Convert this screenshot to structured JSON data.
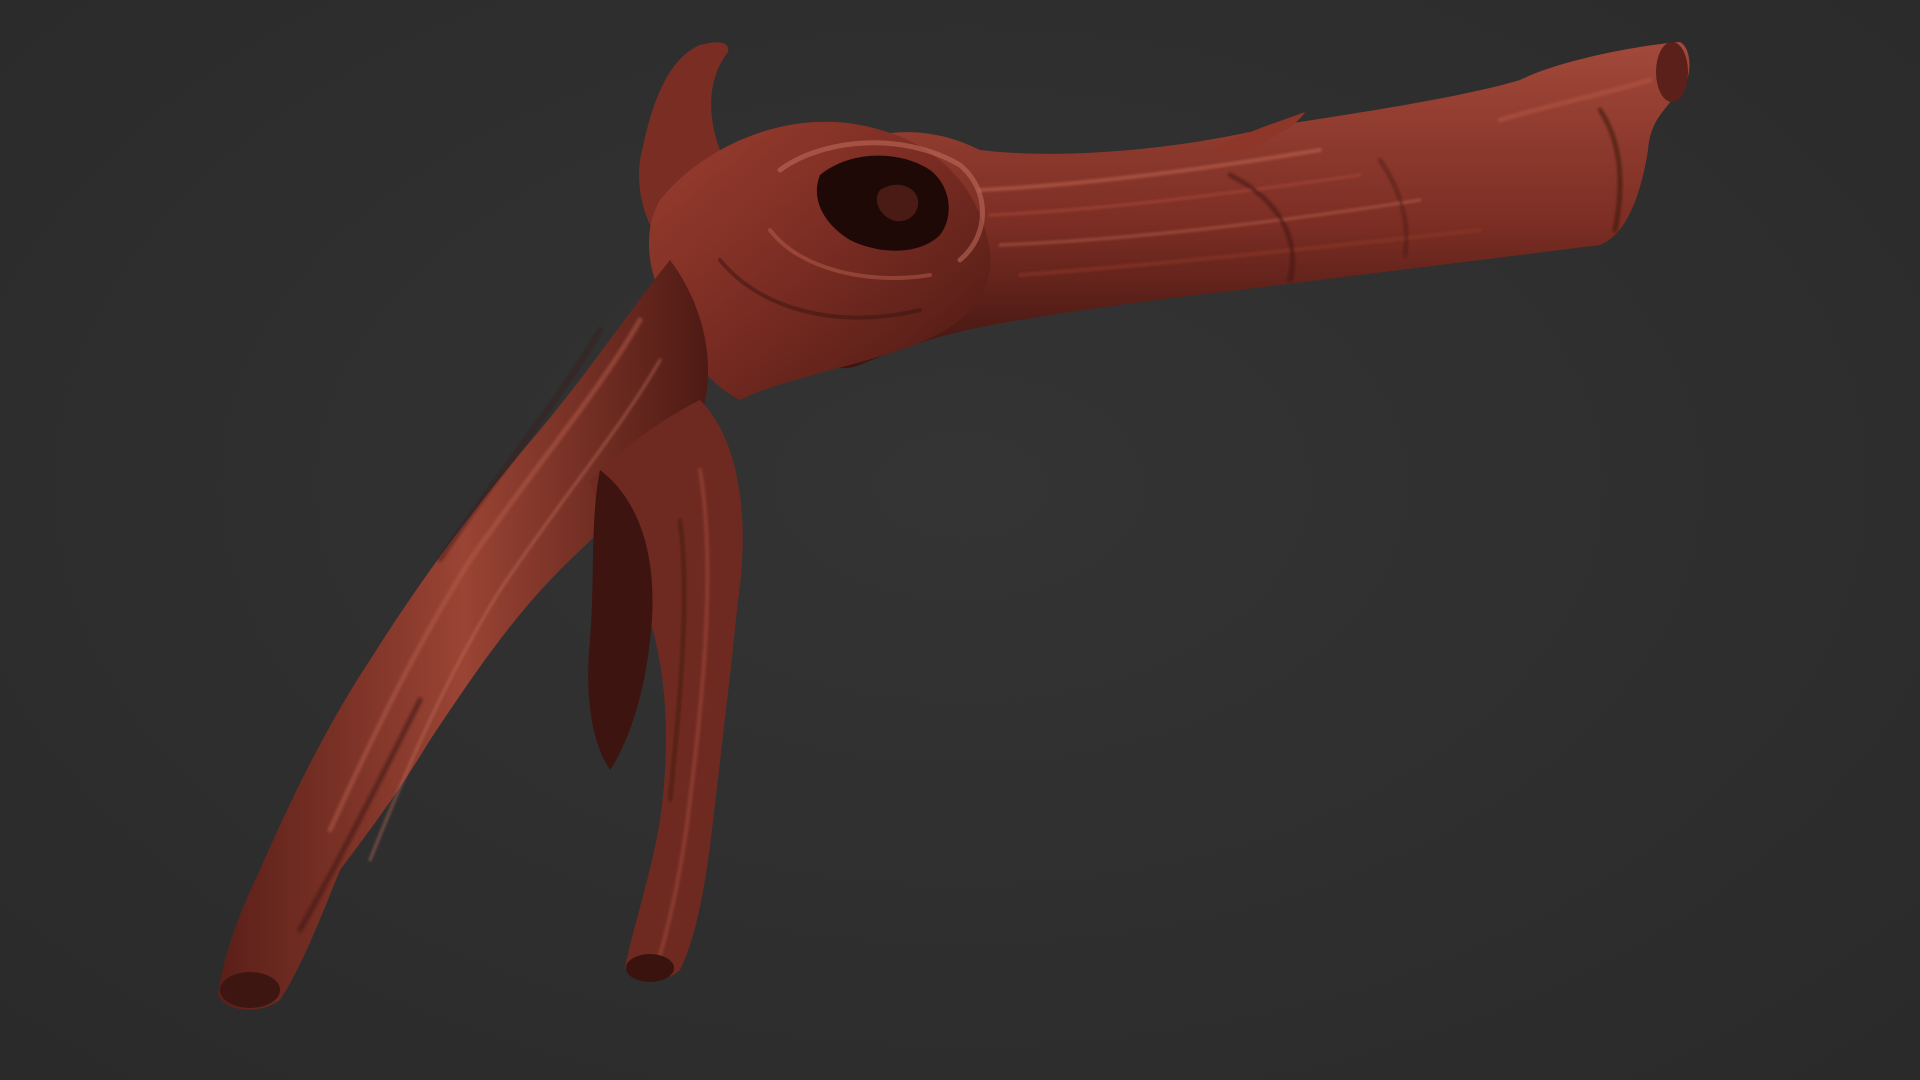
{
  "scene": {
    "subject_icon": "branch-icon",
    "background_color": "#2f2f2f",
    "wood_colors": {
      "base": "#7a2c22",
      "mid": "#933a2d",
      "highlight": "#b45a48",
      "shadow": "#3a1410",
      "deep": "#220a08"
    }
  }
}
